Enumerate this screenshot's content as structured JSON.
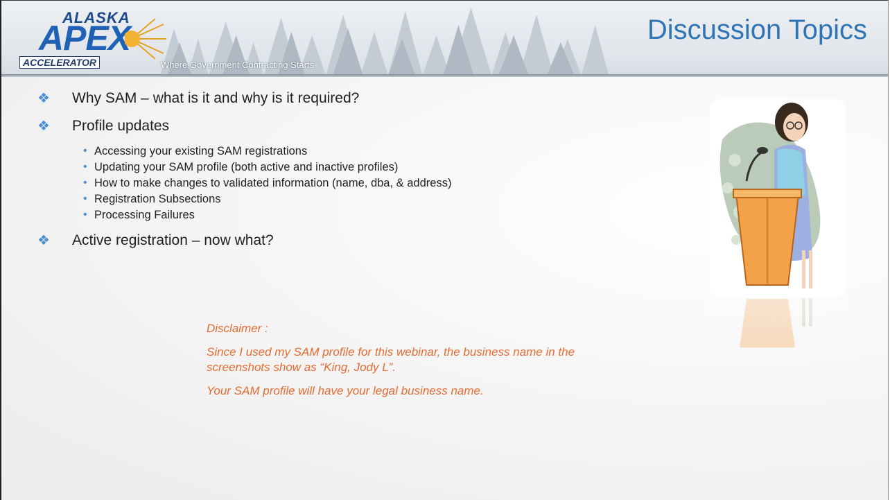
{
  "header": {
    "logo": {
      "alaska": "ALASKA",
      "apex": "APEX",
      "accelerator": "ACCELERATOR"
    },
    "tagline": "Where Government Contracting Starts",
    "title": "Discussion Topics"
  },
  "topics": [
    {
      "label": "Why SAM – what is it and why is it required?"
    },
    {
      "label": "Profile updates",
      "subitems": [
        "Accessing your existing SAM registrations",
        "Updating your SAM profile (both active and inactive profiles)",
        "How to make changes to validated information (name, dba, & address)",
        "Registration Subsections",
        "Processing Failures"
      ]
    },
    {
      "label": "Active registration – now what?"
    }
  ],
  "disclaimer": {
    "heading": "Disclaimer :",
    "line1": "Since I used my SAM profile for this webinar, the business name in the screenshots show as “King, Jody L”.",
    "line2": "Your SAM profile will have your legal business name."
  },
  "colors": {
    "title": "#2f74b5",
    "bullet": "#4a8fd0",
    "disclaimer": "#e56b30"
  },
  "icons": {
    "bullet": "diamond-bullet-icon",
    "clipart": "speaker-at-podium-clipart"
  }
}
